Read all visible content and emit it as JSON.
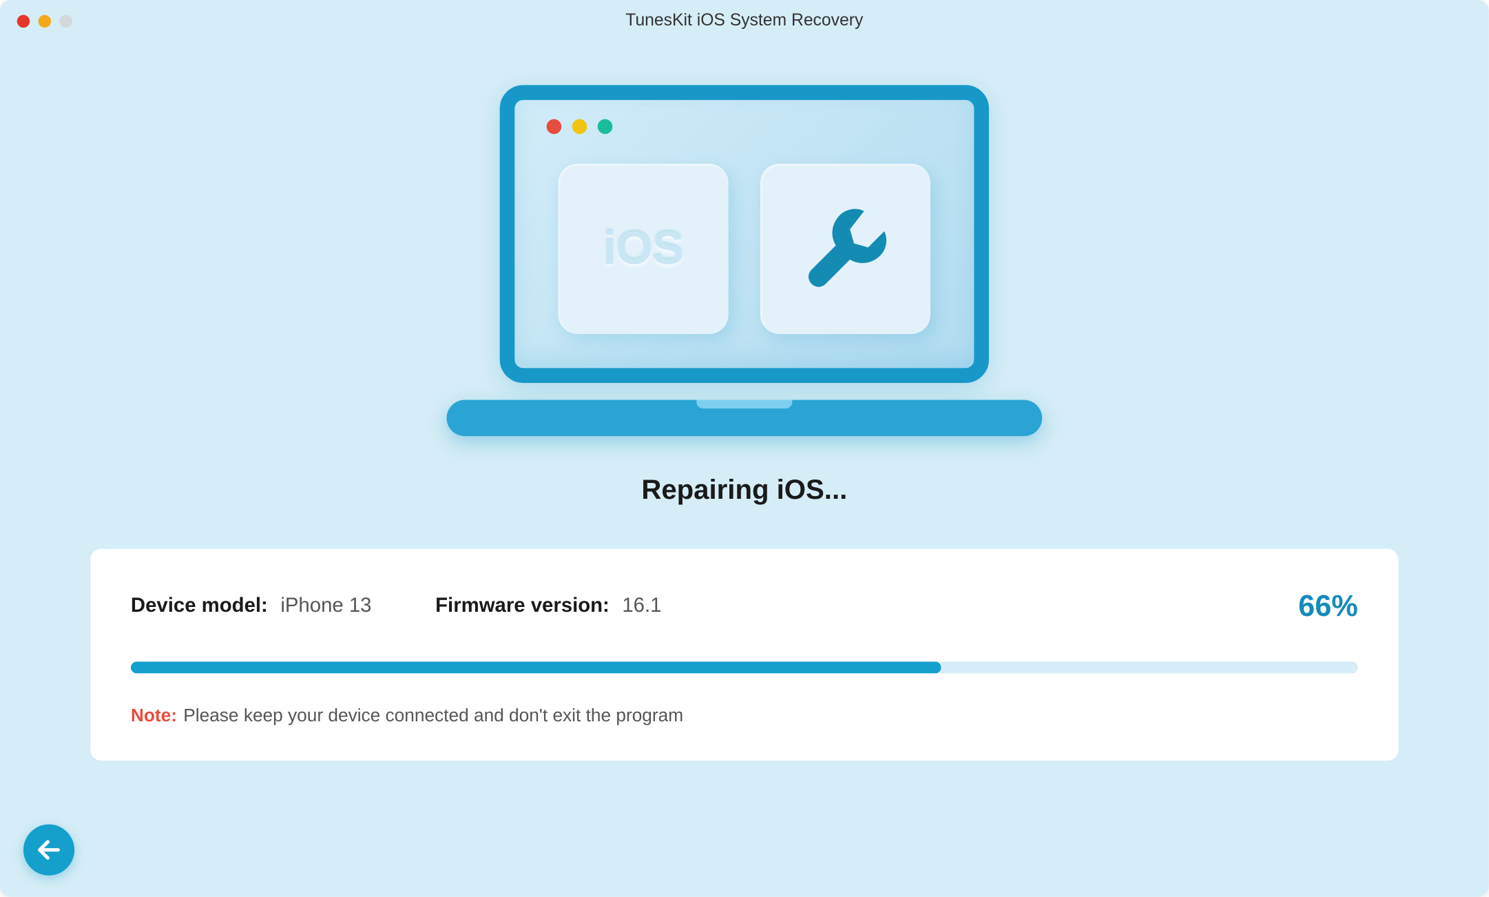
{
  "window": {
    "title": "TunesKit iOS System Recovery"
  },
  "illustration": {
    "tile_label": "iOS"
  },
  "status": {
    "heading": "Repairing iOS..."
  },
  "info": {
    "device_model_label": "Device model:",
    "device_model_value": "iPhone 13",
    "firmware_label": "Firmware version:",
    "firmware_value": "16.1"
  },
  "progress": {
    "percent_label": "66%",
    "percent_value": 66
  },
  "note": {
    "label": "Note:",
    "text": "Please keep your device connected and don't exit the program"
  }
}
